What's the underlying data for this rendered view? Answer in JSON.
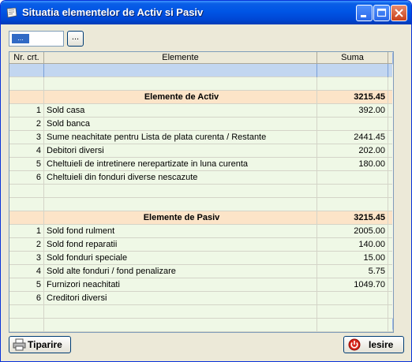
{
  "window": {
    "title": "Situatia elementelor de Activ si Pasiv"
  },
  "toolbar": {
    "date_value": "...",
    "browse_label": "..."
  },
  "table": {
    "columns": [
      "Nr. crt.",
      "Elemente",
      "Suma"
    ],
    "rows": [
      {
        "nr": "",
        "element": "",
        "suma": "",
        "kind": "selected"
      },
      {
        "nr": "",
        "element": "",
        "suma": "",
        "kind": "plain"
      },
      {
        "nr": "",
        "element": "Elemente de Activ",
        "suma": "3215.45",
        "kind": "section"
      },
      {
        "nr": "1",
        "element": "Sold casa",
        "suma": "392.00",
        "kind": "plain"
      },
      {
        "nr": "2",
        "element": "Sold banca",
        "suma": "",
        "kind": "plain"
      },
      {
        "nr": "3",
        "element": "Sume neachitate pentru Lista de plata curenta / Restante",
        "suma": "2441.45",
        "kind": "plain"
      },
      {
        "nr": "4",
        "element": "Debitori diversi",
        "suma": "202.00",
        "kind": "plain"
      },
      {
        "nr": "5",
        "element": "Cheltuieli de intretinere nerepartizate in luna curenta",
        "suma": "180.00",
        "kind": "plain"
      },
      {
        "nr": "6",
        "element": "Cheltuieli din fonduri diverse nescazute",
        "suma": "",
        "kind": "plain"
      },
      {
        "nr": "",
        "element": "",
        "suma": "",
        "kind": "plain"
      },
      {
        "nr": "",
        "element": "",
        "suma": "",
        "kind": "plain"
      },
      {
        "nr": "",
        "element": "Elemente de Pasiv",
        "suma": "3215.45",
        "kind": "section"
      },
      {
        "nr": "1",
        "element": "Sold fond rulment",
        "suma": "2005.00",
        "kind": "plain"
      },
      {
        "nr": "2",
        "element": "Sold fond reparatii",
        "suma": "140.00",
        "kind": "plain"
      },
      {
        "nr": "3",
        "element": "Sold fonduri speciale",
        "suma": "15.00",
        "kind": "plain"
      },
      {
        "nr": "4",
        "element": "Sold alte fonduri / fond penalizare",
        "suma": "5.75",
        "kind": "plain"
      },
      {
        "nr": "5",
        "element": "Furnizori neachitati",
        "suma": "1049.70",
        "kind": "plain"
      },
      {
        "nr": "6",
        "element": "Creditori diversi",
        "suma": "",
        "kind": "plain"
      },
      {
        "nr": "",
        "element": "",
        "suma": "",
        "kind": "plain"
      },
      {
        "nr": "",
        "element": "",
        "suma": "",
        "kind": "plain"
      }
    ]
  },
  "footer": {
    "print_label": "Tiparire",
    "exit_label": "Iesire"
  },
  "icons": {
    "title": "window-app-icon",
    "print": "printer-icon",
    "exit": "power-icon"
  }
}
